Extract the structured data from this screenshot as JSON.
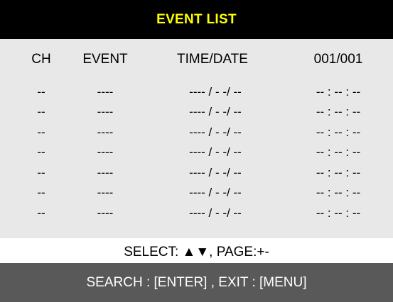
{
  "title": "EVENT LIST",
  "columns": {
    "ch": "CH",
    "event": "EVENT",
    "time_date": "TIME/DATE",
    "page": "001/001"
  },
  "rows": [
    {
      "ch": "--",
      "event": "----",
      "date": "---- / - -/ --",
      "time": "-- : -- : --"
    },
    {
      "ch": "--",
      "event": "----",
      "date": "---- / - -/ --",
      "time": "-- : -- : --"
    },
    {
      "ch": "--",
      "event": "----",
      "date": "---- / - -/ --",
      "time": "-- : -- : --"
    },
    {
      "ch": "--",
      "event": "----",
      "date": "---- / - -/ --",
      "time": "-- : -- : --"
    },
    {
      "ch": "--",
      "event": "----",
      "date": "---- / - -/ --",
      "time": "-- : -- : --"
    },
    {
      "ch": "--",
      "event": "----",
      "date": "---- / - -/ --",
      "time": "-- : -- : --"
    },
    {
      "ch": "--",
      "event": "----",
      "date": "---- / - -/ --",
      "time": "-- : -- : --"
    }
  ],
  "select_hint": "SELECT: ▲▼, PAGE:+-",
  "footer": "SEARCH : [ENTER] , EXIT : [MENU]",
  "colors": {
    "title_bg": "#000000",
    "title_text": "#ffff00",
    "panel_bg": "#e8e8e8",
    "footer_bg": "#595959",
    "footer_text": "#ffffff"
  }
}
